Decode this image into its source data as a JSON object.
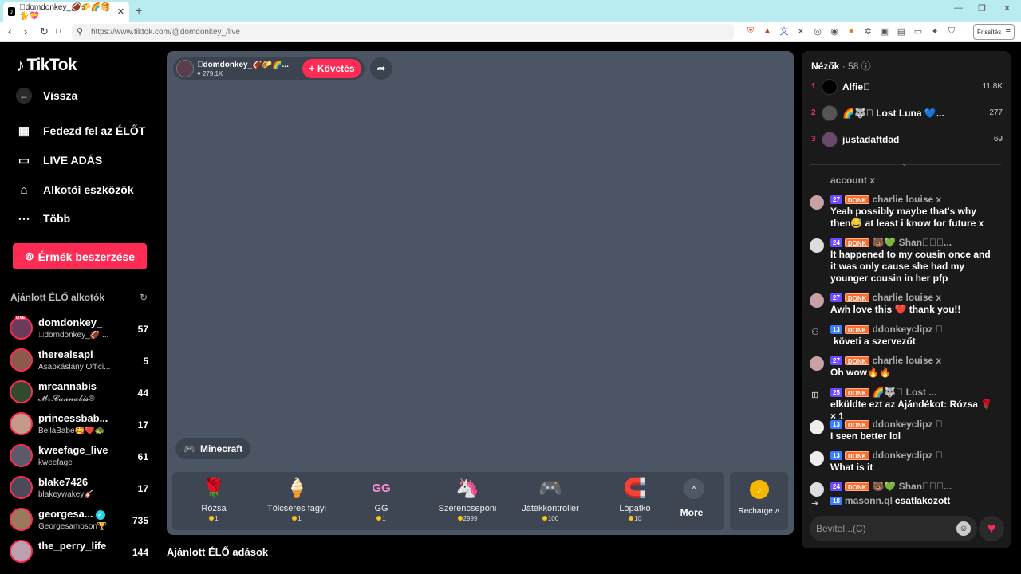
{
  "browser": {
    "tab_title": "\u0000domdonkey_🏈🌮🌈🥞🐈💝",
    "tab_close": "✕",
    "new_tab": "+",
    "url": "https://www.tiktok.com/@domdonkey_/live",
    "refresh_label": "Frissítés"
  },
  "sidebar": {
    "logo": "TikTok",
    "back": "Vissza",
    "nav": [
      {
        "label": "Fedezd fel az ÉLŐT"
      },
      {
        "label": "LIVE ADÁS"
      },
      {
        "label": "Alkotói eszközök"
      },
      {
        "label": "Több"
      }
    ],
    "coin_button": "Érmék beszerzése",
    "recommended_title": "Ajánlott ÉLŐ alkotók",
    "creators": [
      {
        "name": "domdonkey_",
        "sub": "\u0000domdonkey_🏈 ...",
        "count": "57"
      },
      {
        "name": "therealsapi",
        "sub": "Asapkáslány Offici...",
        "count": "5"
      },
      {
        "name": "mrcannabis_",
        "sub": "𝓜𝓻.𝓒𝓪𝓷𝓷𝓪𝓫𝓲𝓼®",
        "count": "44"
      },
      {
        "name": "princessbab...",
        "sub": "BellaBabe🥰❤️🐢",
        "count": "17"
      },
      {
        "name": "kweefage_live",
        "sub": "kweefage",
        "count": "61"
      },
      {
        "name": "blake7426",
        "sub": "blakeywakey🎸",
        "count": "17"
      },
      {
        "name": "georgesa...",
        "sub": "Georgesampson🏆",
        "count": "735"
      },
      {
        "name": "the_perry_life",
        "sub": "",
        "count": "144"
      }
    ],
    "live_badge": "LIVE"
  },
  "stream": {
    "host_name": "\u0000domdonkey_🏈🌮🌈...",
    "host_likes": "279.1K",
    "follow_label": "+ Követés",
    "game_tag": "Minecraft",
    "gifts": [
      {
        "icon": "🌹",
        "name": "Rózsa",
        "price": "1"
      },
      {
        "icon": "🍦",
        "name": "Tölcséres fagyi",
        "price": "1"
      },
      {
        "icon": "GG",
        "name": "GG",
        "price": "1"
      },
      {
        "icon": "🦄",
        "name": "Szerencsepóni",
        "price": "2999"
      },
      {
        "icon": "🎮",
        "name": "Játékkontroller",
        "price": "100"
      },
      {
        "icon": "🧲",
        "name": "Lópatkó",
        "price": "10"
      }
    ],
    "more_label": "More",
    "recharge_label": "Recharge ˄",
    "recommended_live": "Ajánlott ÉLŐ adások"
  },
  "panel": {
    "viewers_label": "Nézők",
    "viewers_count": "· 58",
    "top_viewers": [
      {
        "rank": "1",
        "name": "Alfie\u0000",
        "score": "11.8K"
      },
      {
        "rank": "2",
        "name": "🌈🐺\u0000 Lost Luna 💙...",
        "score": "277"
      },
      {
        "rank": "3",
        "name": "justadaftdad",
        "score": "69"
      }
    ],
    "chat": [
      {
        "type": "system",
        "user": "",
        "level": "",
        "fan": "",
        "text": "account x"
      },
      {
        "type": "msg",
        "user": "charlie louise x",
        "level": "27",
        "fan": "DONK",
        "text": "Yeah possibly maybe that's why then😅 at least i know for future x"
      },
      {
        "type": "msg",
        "user": "🐻💚 Shan\u0000\u0000\u0000...",
        "level": "24",
        "fan": "DONK",
        "text": "It happened to my cousin once and it was only cause she had my younger cousin in her pfp"
      },
      {
        "type": "msg",
        "user": "charlie louise x",
        "level": "27",
        "fan": "DONK",
        "text": "Awh love this ❤️ thank you!!"
      },
      {
        "type": "follow",
        "user": "ddonkeyclipz \u0000",
        "level": "13",
        "fan": "DONK",
        "text": "követi a szervezőt"
      },
      {
        "type": "msg",
        "user": "charlie louise x",
        "level": "27",
        "fan": "DONK",
        "text": "Oh wow🔥🔥"
      },
      {
        "type": "gift",
        "user": "🌈🐺\u0000 Lost ...",
        "level": "25",
        "fan": "DONK",
        "text": "elküldte ezt az Ajándékot: Rózsa 🌹 × 1"
      },
      {
        "type": "msg",
        "user": "ddonkeyclipz \u0000",
        "level": "13",
        "fan": "DONK",
        "text": "I seen better lol"
      },
      {
        "type": "msg",
        "user": "ddonkeyclipz \u0000",
        "level": "13",
        "fan": "DONK",
        "text": "What is it"
      },
      {
        "type": "msg",
        "user": "🐻💚 Shan\u0000\u0000\u0000...",
        "level": "24",
        "fan": "DONK",
        "text": ""
      },
      {
        "type": "join",
        "user": "masonn.ql",
        "level": "18",
        "fan": "",
        "text": "csatlakozott"
      }
    ],
    "input_placeholder": "Bevitel...(C)"
  }
}
